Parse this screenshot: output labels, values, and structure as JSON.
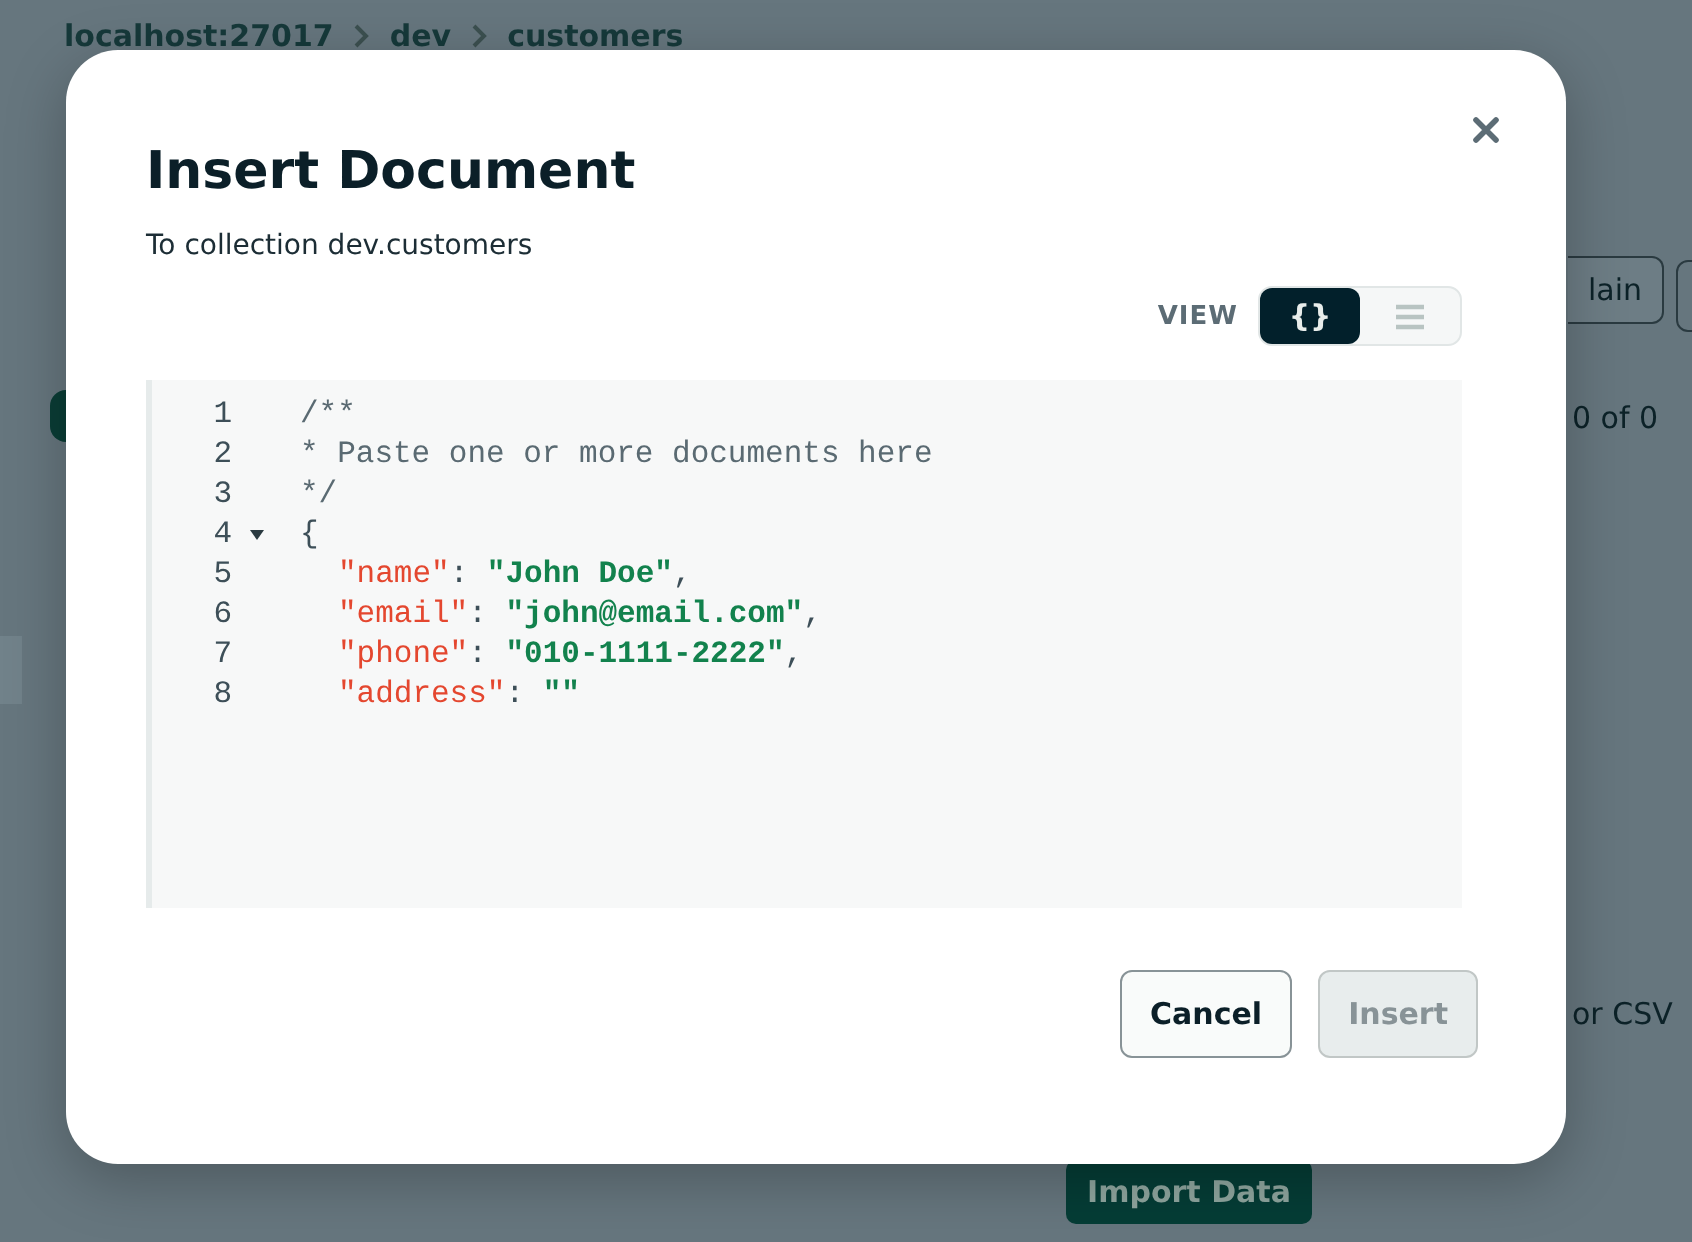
{
  "background": {
    "breadcrumb": [
      "localhost:27017",
      "dev",
      "customers"
    ],
    "explain_button": "lain",
    "pagination": "0 of 0",
    "import_hint": "or CSV",
    "import_button": "Import Data"
  },
  "dialog": {
    "title": "Insert Document",
    "subtitle": "To collection dev.customers",
    "view_label": "VIEW",
    "view_options": [
      {
        "kind": "json",
        "label": "{}",
        "selected": true
      },
      {
        "kind": "list",
        "selected": false
      }
    ],
    "lines": [
      {
        "number": "1",
        "tokens": [
          {
            "kind": "comment",
            "text": "/**"
          }
        ]
      },
      {
        "number": "2",
        "tokens": [
          {
            "kind": "comment",
            "text": "* Paste one or more documents here"
          }
        ]
      },
      {
        "number": "3",
        "tokens": [
          {
            "kind": "comment",
            "text": "*/"
          }
        ]
      },
      {
        "number": "4",
        "expanded": true,
        "tokens": [
          {
            "kind": "punct",
            "text": "{"
          }
        ],
        "children": [
          {
            "number": "5",
            "tokens": [
              {
                "kind": "key",
                "text": "\"name\""
              },
              {
                "kind": "punct",
                "text": ": "
              },
              {
                "kind": "string",
                "text": "\"John Doe\""
              },
              {
                "kind": "punct",
                "text": ","
              }
            ]
          },
          {
            "number": "6",
            "tokens": [
              {
                "kind": "key",
                "text": "\"email\""
              },
              {
                "kind": "punct",
                "text": ": "
              },
              {
                "kind": "string",
                "text": "\"john@email.com\""
              },
              {
                "kind": "punct",
                "text": ","
              }
            ]
          },
          {
            "number": "7",
            "tokens": [
              {
                "kind": "key",
                "text": "\"phone\""
              },
              {
                "kind": "punct",
                "text": ": "
              },
              {
                "kind": "string",
                "text": "\"010-1111-2222\""
              },
              {
                "kind": "punct",
                "text": ","
              }
            ]
          },
          {
            "number": "8",
            "tokens": [
              {
                "kind": "key",
                "text": "\"address\""
              },
              {
                "kind": "punct",
                "text": ": "
              },
              {
                "kind": "string",
                "text": "\"\""
              }
            ]
          }
        ]
      }
    ],
    "buttons": [
      {
        "label": "Cancel",
        "disabled": false
      },
      {
        "label": "Insert",
        "disabled": true
      }
    ]
  }
}
